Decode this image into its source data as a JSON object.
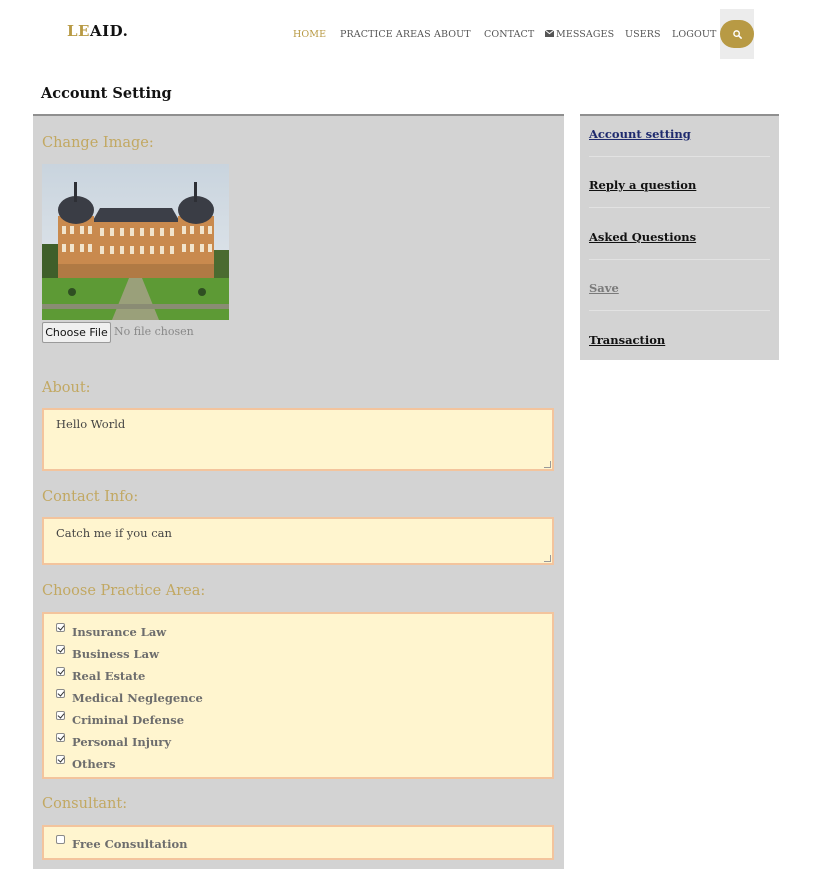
{
  "brand": {
    "logo_part1": "LE",
    "logo_part2": "AID."
  },
  "nav": {
    "home": "HOME",
    "practice_areas": "PRACTICE AREAS",
    "about": "ABOUT",
    "contact": "CONTACT",
    "messages": "MESSAGES",
    "users": "USERS",
    "logout": "LOGOUT",
    "search_icon": "search-icon"
  },
  "page": {
    "title": "Account Setting"
  },
  "form": {
    "change_image_label": "Change Image:",
    "choose_file_button": "Choose File",
    "no_file_text": "No file chosen",
    "about_label": "About:",
    "about_value": "Hello World",
    "contact_label": "Contact Info:",
    "contact_value": "Catch me if you can",
    "practice_label": "Choose Practice Area:",
    "practice_areas": [
      {
        "label": "Insurance Law",
        "checked": true
      },
      {
        "label": "Business Law",
        "checked": true
      },
      {
        "label": "Real Estate",
        "checked": true
      },
      {
        "label": "Medical Neglegence",
        "checked": true
      },
      {
        "label": "Criminal Defense",
        "checked": true
      },
      {
        "label": "Personal Injury",
        "checked": true
      },
      {
        "label": "Others",
        "checked": true
      }
    ],
    "consultant_label": "Consultant:",
    "consultation": {
      "label": "Free Consultation",
      "checked": false
    }
  },
  "sidebar": {
    "items": [
      {
        "label": "Account setting",
        "state": "active"
      },
      {
        "label": "Reply a question",
        "state": "normal"
      },
      {
        "label": "Asked Questions",
        "state": "normal"
      },
      {
        "label": "Save",
        "state": "muted"
      },
      {
        "label": "Transaction",
        "state": "normal"
      }
    ]
  },
  "colors": {
    "accent": "#b89a44",
    "panel": "#d3d3d3",
    "field_bg": "#fff5cf",
    "field_border": "#f3c49d",
    "label_gold": "#c2a862",
    "sidebar_active": "#1e2a6e"
  }
}
